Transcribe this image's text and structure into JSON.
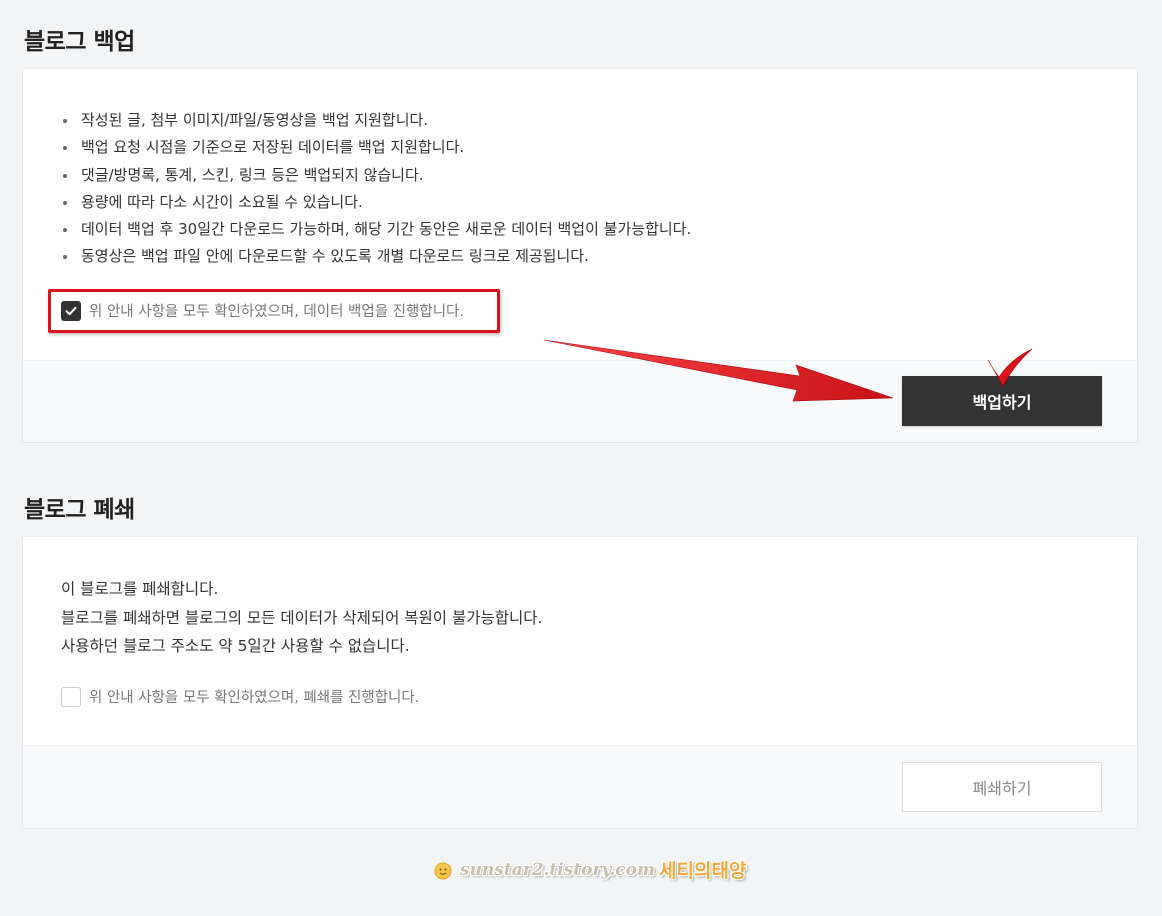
{
  "backup": {
    "title": "블로그 백업",
    "notices": [
      "작성된 글, 첨부 이미지/파일/동영상을 백업 지원합니다.",
      "백업 요청 시점을 기준으로 저장된 데이터를 백업 지원합니다.",
      "댓글/방명록, 통계, 스킨, 링크 등은 백업되지 않습니다.",
      "용량에 따라 다소 시간이 소요될 수 있습니다.",
      "데이터 백업 후 30일간 다운로드 가능하며, 해당 기간 동안은 새로운 데이터 백업이 불가능합니다.",
      "동영상은 백업 파일 안에 다운로드할 수 있도록 개별 다운로드 링크로 제공됩니다."
    ],
    "confirm_label": "위 안내 사항을 모두 확인하였으며, 데이터 백업을 진행합니다.",
    "confirm_checked": true,
    "button_label": "백업하기"
  },
  "close": {
    "title": "블로그 폐쇄",
    "description": [
      "이 블로그를 폐쇄합니다.",
      "블로그를 폐쇄하면 블로그의 모든 데이터가 삭제되어 복원이 불가능합니다.",
      "사용하던 블로그 주소도 약 5일간 사용할 수 없습니다."
    ],
    "confirm_label": "위 안내 사항을 모두 확인하였으며, 폐쇄를 진행합니다.",
    "confirm_checked": false,
    "button_label": "폐쇄하기"
  },
  "watermark": {
    "url": "sunstar2.tistory.com",
    "name": "세티의태양"
  },
  "colors": {
    "annotation_red": "#d9131c",
    "primary_button": "#333333"
  }
}
